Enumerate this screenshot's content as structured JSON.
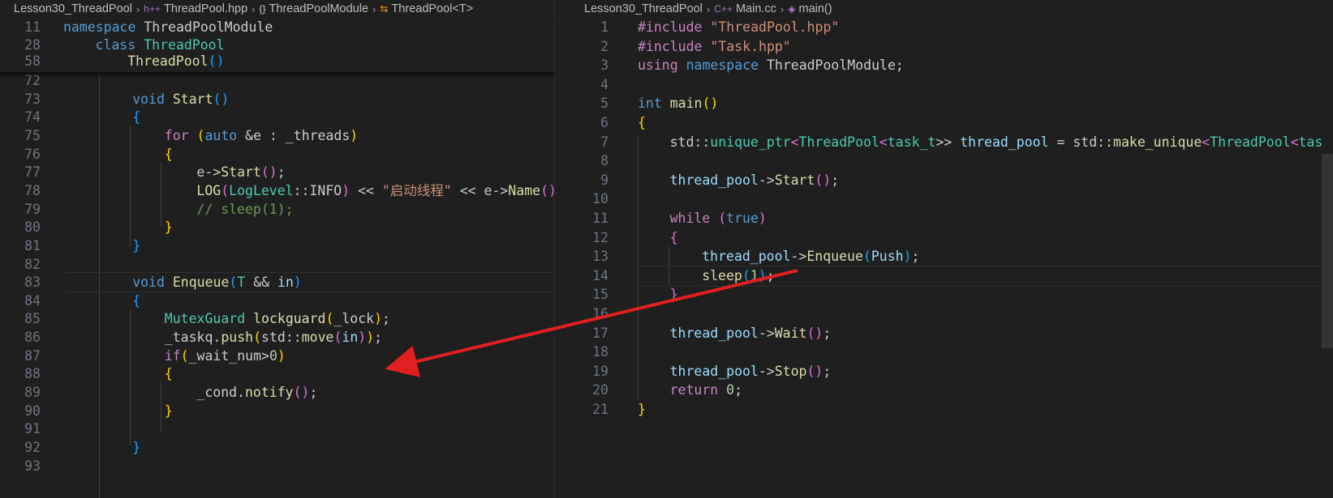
{
  "left": {
    "breadcrumb": [
      {
        "icon": "",
        "text": "Lesson30_ThreadPool"
      },
      {
        "icon": "h++",
        "text": "ThreadPool.hpp"
      },
      {
        "icon": "{}",
        "text": "ThreadPoolModule"
      },
      {
        "icon": "class-icon",
        "text": "ThreadPool<T>"
      }
    ],
    "sticky": [
      {
        "n": "11",
        "indent": 0,
        "tokens": [
          [
            "namespace ",
            "kw"
          ],
          [
            "ThreadPoolModule",
            "txt"
          ]
        ]
      },
      {
        "n": "28",
        "indent": 1,
        "tokens": [
          [
            "class ",
            "kw"
          ],
          [
            "ThreadPool",
            "type"
          ]
        ]
      },
      {
        "n": "58",
        "indent": 2,
        "tokens": [
          [
            "ThreadPool",
            "fn"
          ],
          [
            "()",
            "p3"
          ]
        ]
      }
    ],
    "lines": [
      {
        "n": "72",
        "indent": 0,
        "tokens": []
      },
      {
        "n": "73",
        "indent": 2,
        "tokens": [
          [
            "void ",
            "kw"
          ],
          [
            "Start",
            "fn"
          ],
          [
            "()",
            "p3"
          ]
        ]
      },
      {
        "n": "74",
        "indent": 2,
        "tokens": [
          [
            "{",
            "p3"
          ]
        ]
      },
      {
        "n": "75",
        "indent": 3,
        "tokens": [
          [
            "for ",
            "ctl"
          ],
          [
            "(",
            "p1"
          ],
          [
            "auto ",
            "kw"
          ],
          [
            "&e : _threads",
            "txt"
          ],
          [
            ")",
            "p1"
          ]
        ]
      },
      {
        "n": "76",
        "indent": 3,
        "tokens": [
          [
            "{",
            "p1"
          ]
        ]
      },
      {
        "n": "77",
        "indent": 4,
        "tokens": [
          [
            "e->",
            "txt"
          ],
          [
            "Start",
            "fn"
          ],
          [
            "()",
            "p2"
          ],
          [
            ";",
            "txt"
          ]
        ]
      },
      {
        "n": "78",
        "indent": 4,
        "tokens": [
          [
            "LOG",
            "fn"
          ],
          [
            "(",
            "p2"
          ],
          [
            "LogLevel",
            "type"
          ],
          [
            "::INFO",
            "txt"
          ],
          [
            ")",
            "p2"
          ],
          [
            " << ",
            "txt"
          ],
          [
            "\"启动线程\"",
            "str"
          ],
          [
            " << e->",
            "txt"
          ],
          [
            "Name",
            "fn"
          ],
          [
            "()",
            "p2"
          ],
          [
            ";",
            "txt"
          ]
        ]
      },
      {
        "n": "79",
        "indent": 4,
        "tokens": [
          [
            "// sleep(1);",
            "com"
          ]
        ]
      },
      {
        "n": "80",
        "indent": 3,
        "tokens": [
          [
            "}",
            "p1"
          ]
        ]
      },
      {
        "n": "81",
        "indent": 2,
        "tokens": [
          [
            "}",
            "p3"
          ]
        ]
      },
      {
        "n": "82",
        "indent": 0,
        "tokens": []
      },
      {
        "n": "83",
        "indent": 2,
        "tokens": [
          [
            "void ",
            "kw"
          ],
          [
            "Enqueue",
            "fn"
          ],
          [
            "(",
            "p3"
          ],
          [
            "T",
            "type"
          ],
          [
            " && ",
            "txt"
          ],
          [
            "in",
            "var"
          ],
          [
            ")",
            "p3"
          ]
        ]
      },
      {
        "n": "84",
        "indent": 2,
        "tokens": [
          [
            "{",
            "p3"
          ]
        ]
      },
      {
        "n": "85",
        "indent": 3,
        "tokens": [
          [
            "MutexGuard ",
            "type"
          ],
          [
            "lockguard",
            "fn"
          ],
          [
            "(",
            "p1"
          ],
          [
            "_lock",
            "txt"
          ],
          [
            ")",
            "p1"
          ],
          [
            ";",
            "txt"
          ]
        ]
      },
      {
        "n": "86",
        "indent": 3,
        "tokens": [
          [
            "_taskq.",
            "txt"
          ],
          [
            "push",
            "fn"
          ],
          [
            "(",
            "p1"
          ],
          [
            "std::",
            "txt"
          ],
          [
            "move",
            "fn"
          ],
          [
            "(",
            "p2"
          ],
          [
            "in",
            "var"
          ],
          [
            ")",
            "p2"
          ],
          [
            ")",
            "p1"
          ],
          [
            ";",
            "txt"
          ]
        ]
      },
      {
        "n": "87",
        "indent": 3,
        "tokens": [
          [
            "if",
            "ctl"
          ],
          [
            "(",
            "p1"
          ],
          [
            "_wait_num>",
            "txt"
          ],
          [
            "0",
            "num"
          ],
          [
            ")",
            "p1"
          ]
        ]
      },
      {
        "n": "88",
        "indent": 3,
        "tokens": [
          [
            "{",
            "p1"
          ]
        ]
      },
      {
        "n": "89",
        "indent": 4,
        "tokens": [
          [
            "_cond.",
            "txt"
          ],
          [
            "notify",
            "fn"
          ],
          [
            "()",
            "p2"
          ],
          [
            ";",
            "txt"
          ]
        ]
      },
      {
        "n": "90",
        "indent": 3,
        "tokens": [
          [
            "}",
            "p1"
          ]
        ]
      },
      {
        "n": "91",
        "indent": 0,
        "tokens": []
      },
      {
        "n": "92",
        "indent": 2,
        "tokens": [
          [
            "}",
            "p3"
          ]
        ]
      },
      {
        "n": "93",
        "indent": 0,
        "tokens": []
      }
    ]
  },
  "right": {
    "breadcrumb": [
      {
        "icon": "",
        "text": "Lesson30_ThreadPool"
      },
      {
        "icon": "C++",
        "text": "Main.cc"
      },
      {
        "icon": "cube-icon",
        "text": "main()"
      }
    ],
    "lines": [
      {
        "n": "1",
        "indent": 0,
        "tokens": [
          [
            "#include ",
            "pre"
          ],
          [
            "\"ThreadPool.hpp\"",
            "str"
          ]
        ]
      },
      {
        "n": "2",
        "indent": 0,
        "tokens": [
          [
            "#include ",
            "pre"
          ],
          [
            "\"Task.hpp\"",
            "str"
          ]
        ]
      },
      {
        "n": "3",
        "indent": 0,
        "tokens": [
          [
            "using ",
            "ctl"
          ],
          [
            "namespace ",
            "kw"
          ],
          [
            "ThreadPoolModule",
            "txt"
          ],
          [
            ";",
            "txt"
          ]
        ]
      },
      {
        "n": "4",
        "indent": 0,
        "tokens": []
      },
      {
        "n": "5",
        "indent": 0,
        "tokens": [
          [
            "int ",
            "kw"
          ],
          [
            "main",
            "fn"
          ],
          [
            "()",
            "p1"
          ]
        ]
      },
      {
        "n": "6",
        "indent": 0,
        "tokens": [
          [
            "{",
            "p1"
          ]
        ]
      },
      {
        "n": "7",
        "indent": 1,
        "tokens": [
          [
            "std::",
            "txt"
          ],
          [
            "unique_ptr",
            "type"
          ],
          [
            "<",
            "p2"
          ],
          [
            "ThreadPool",
            "type"
          ],
          [
            "<",
            "p2"
          ],
          [
            "task_t",
            "type"
          ],
          [
            ">>",
            "txt"
          ],
          [
            " thread_pool",
            "var"
          ],
          [
            " = std::",
            "txt"
          ],
          [
            "make_unique",
            "fn"
          ],
          [
            "<",
            "p2"
          ],
          [
            "ThreadPool",
            "type"
          ],
          [
            "<",
            "p2"
          ],
          [
            "task_t",
            "type"
          ],
          [
            ">",
            "txt"
          ]
        ]
      },
      {
        "n": "8",
        "indent": 0,
        "tokens": []
      },
      {
        "n": "9",
        "indent": 1,
        "tokens": [
          [
            "thread_pool",
            "var"
          ],
          [
            "->",
            "txt"
          ],
          [
            "Start",
            "fn"
          ],
          [
            "()",
            "p2"
          ],
          [
            ";",
            "txt"
          ]
        ]
      },
      {
        "n": "10",
        "indent": 0,
        "tokens": []
      },
      {
        "n": "11",
        "indent": 1,
        "tokens": [
          [
            "while ",
            "ctl"
          ],
          [
            "(",
            "p2"
          ],
          [
            "true",
            "kw"
          ],
          [
            ")",
            "p2"
          ]
        ]
      },
      {
        "n": "12",
        "indent": 1,
        "tokens": [
          [
            "{",
            "p2"
          ]
        ]
      },
      {
        "n": "13",
        "indent": 2,
        "tokens": [
          [
            "thread_pool",
            "var"
          ],
          [
            "->",
            "txt"
          ],
          [
            "Enqueue",
            "fn"
          ],
          [
            "(",
            "p3"
          ],
          [
            "Push",
            "var"
          ],
          [
            ")",
            "p3"
          ],
          [
            ";",
            "txt"
          ]
        ]
      },
      {
        "n": "14",
        "indent": 2,
        "tokens": [
          [
            "sleep",
            "fn"
          ],
          [
            "(",
            "p3"
          ],
          [
            "1",
            "num"
          ],
          [
            ")",
            "p3"
          ],
          [
            ";",
            "txt"
          ]
        ]
      },
      {
        "n": "15",
        "indent": 1,
        "tokens": [
          [
            "}",
            "p2"
          ]
        ]
      },
      {
        "n": "16",
        "indent": 0,
        "tokens": []
      },
      {
        "n": "17",
        "indent": 1,
        "tokens": [
          [
            "thread_pool",
            "var"
          ],
          [
            "->",
            "txt"
          ],
          [
            "Wait",
            "fn"
          ],
          [
            "()",
            "p2"
          ],
          [
            ";",
            "txt"
          ]
        ]
      },
      {
        "n": "18",
        "indent": 0,
        "tokens": []
      },
      {
        "n": "19",
        "indent": 1,
        "tokens": [
          [
            "thread_pool",
            "var"
          ],
          [
            "->",
            "txt"
          ],
          [
            "Stop",
            "fn"
          ],
          [
            "()",
            "p2"
          ],
          [
            ";",
            "txt"
          ]
        ]
      },
      {
        "n": "20",
        "indent": 1,
        "tokens": [
          [
            "return ",
            "ctl"
          ],
          [
            "0",
            "num"
          ],
          [
            ";",
            "txt"
          ]
        ]
      },
      {
        "n": "21",
        "indent": 0,
        "tokens": [
          [
            "}",
            "p1"
          ]
        ]
      }
    ]
  },
  "colors": {
    "background": "#1f1f1f",
    "arrow": "#e02020"
  }
}
